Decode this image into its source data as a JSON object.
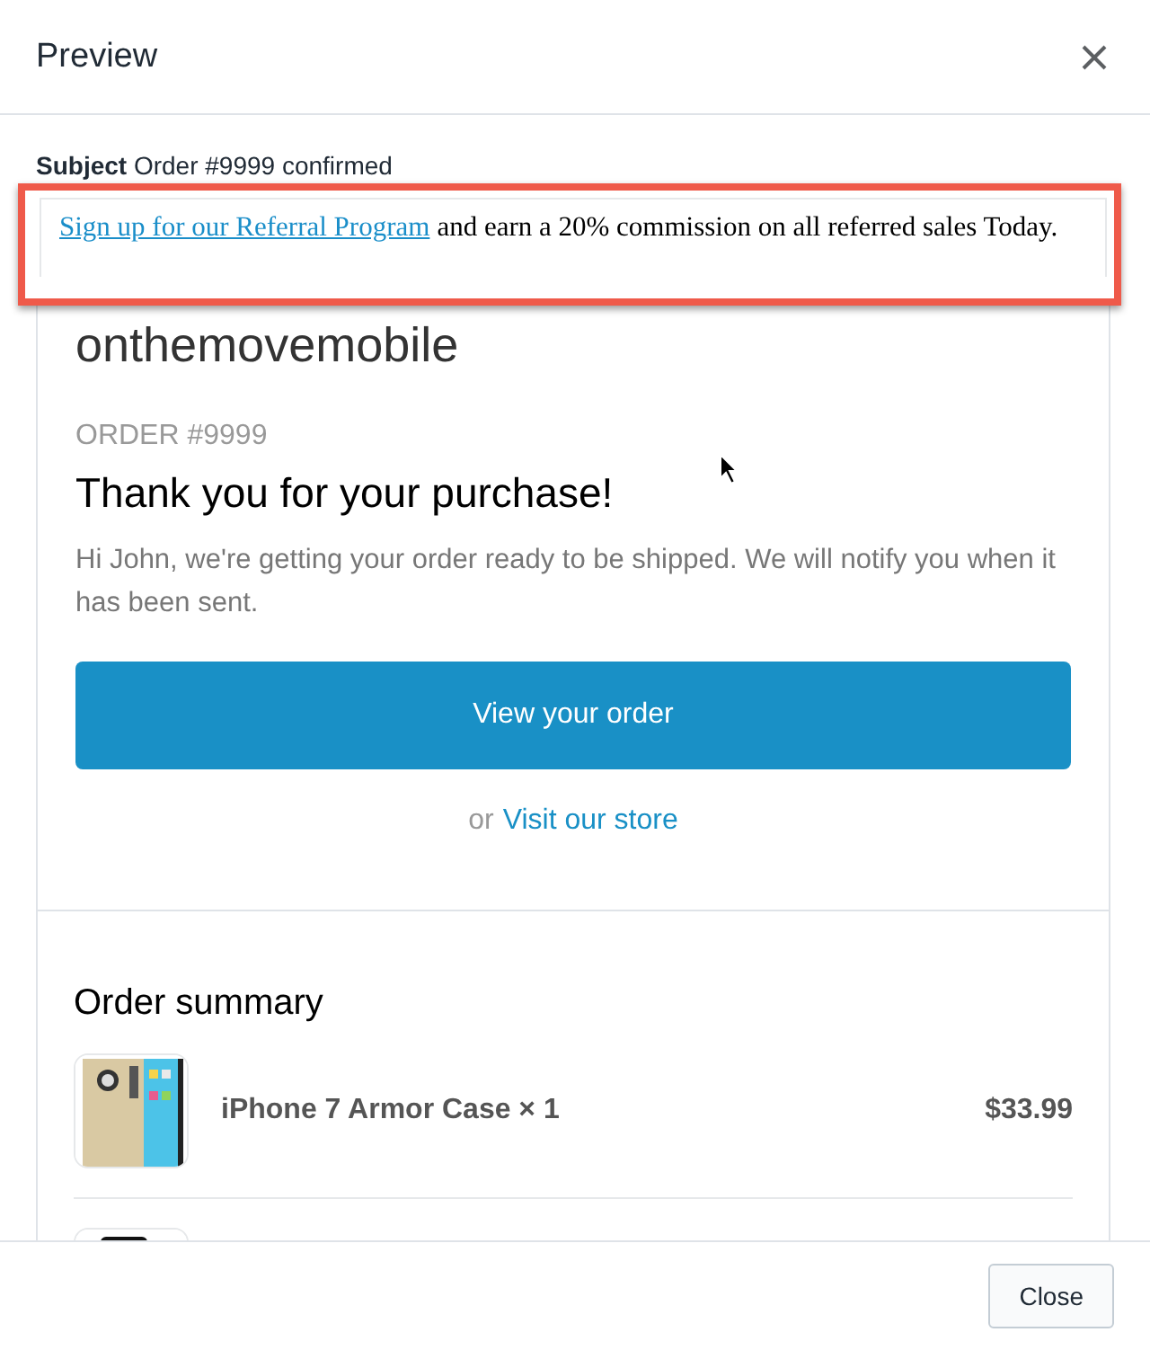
{
  "window": {
    "title": "Preview"
  },
  "subject": {
    "label": "Subject",
    "value": "Order #9999 confirmed"
  },
  "banner": {
    "link": "Sign up for our Referral Program",
    "text": "and earn a 20% commission on all referred sales Today."
  },
  "email": {
    "shop": "onthemovemobile",
    "order": "ORDER #9999",
    "heading": "Thank you for your purchase!",
    "message": "Hi John, we're getting your order ready to be shipped. We will notify you when it has been sent.",
    "button": "View your order",
    "alt_prefix": "or",
    "alt_link": "Visit our store"
  },
  "summary": {
    "title": "Order summary",
    "items": [
      {
        "kind": "picture",
        "name": "iPhone 7 Armor Case × 1",
        "price": "$33.99"
      },
      {
        "kind": "picture"
      }
    ]
  },
  "buttons": [
    "Close"
  ]
}
